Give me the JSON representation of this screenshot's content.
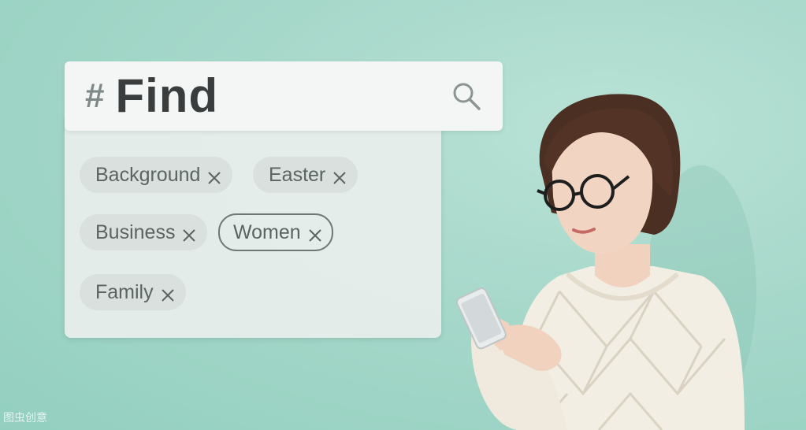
{
  "search": {
    "prefix": "#",
    "query": "Find",
    "icon": "search-icon"
  },
  "tags": [
    {
      "label": "Background",
      "selected": false
    },
    {
      "label": "Easter",
      "selected": false
    },
    {
      "label": "Business",
      "selected": false
    },
    {
      "label": "Women",
      "selected": true
    },
    {
      "label": "Family",
      "selected": false
    }
  ],
  "tag_remove_icon": "close-icon",
  "watermark": "图虫创意",
  "colors": {
    "background": "#a6d8ca",
    "panel": "#e8eeec",
    "header": "#f3f6f5",
    "tag": "#d9e0de",
    "text_dark": "#3a3d3e",
    "text_tag": "#5b6462"
  }
}
